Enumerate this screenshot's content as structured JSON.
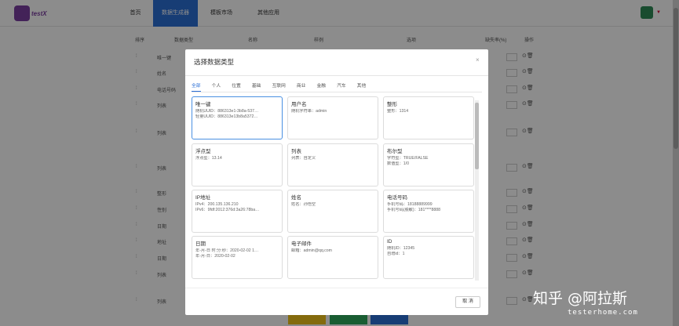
{
  "app": {
    "logo_text": "testX"
  },
  "nav": [
    {
      "label": "首页"
    },
    {
      "label": "数据生成器"
    },
    {
      "label": "模板市场"
    },
    {
      "label": "其他应用"
    }
  ],
  "table": {
    "headers": [
      "排序",
      "数据类型",
      "名称",
      "样例",
      "选项",
      "缺失率(%)",
      "操作"
    ],
    "rows": [
      {
        "label": "唯一键"
      },
      {
        "label": "姓名"
      },
      {
        "label": "电话号码"
      },
      {
        "label": "列表"
      },
      {
        "label": "列表"
      },
      {
        "label": "列表"
      },
      {
        "label": "整形"
      },
      {
        "label": "性别"
      },
      {
        "label": "日期"
      },
      {
        "label": "地址"
      },
      {
        "label": "日期"
      },
      {
        "label": "列表"
      },
      {
        "label": "列表"
      }
    ]
  },
  "modal": {
    "title": "选择数据类型",
    "close_symbol": "×",
    "tabs": [
      "全部",
      "个人",
      "位置",
      "基础",
      "互联网",
      "商业",
      "金融",
      "汽车",
      "其他"
    ],
    "active_tab": "全部",
    "cards": [
      {
        "title": "唯一键",
        "lines": [
          "随机UUID：886313e1-3b8a-537…",
          "轻量UUID：886313e13b8a5372…"
        ],
        "selected": true
      },
      {
        "title": "用户名",
        "lines": [
          "随机字符串：admin"
        ]
      },
      {
        "title": "整形",
        "lines": [
          "整形：1314"
        ]
      },
      {
        "title": "浮点型",
        "lines": [
          "浮点型：13.14"
        ]
      },
      {
        "title": "列表",
        "lines": [
          "列表：自定义"
        ]
      },
      {
        "title": "布尔型",
        "lines": [
          "字符型：TRUE/FALSE",
          "数值型：1/0"
        ]
      },
      {
        "title": "IP地址",
        "lines": [
          "IPv4：200.135.136.210",
          "IPv6：9fdf:2012:376d:3a26:78ba…"
        ]
      },
      {
        "title": "姓名",
        "lines": [
          "姓名：孙悟空"
        ]
      },
      {
        "title": "电话号码",
        "lines": [
          "手机号码：18188889999",
          "手机号码(脱敏)：181****8888"
        ]
      },
      {
        "title": "日期",
        "lines": [
          "年-月-日 时:分:秒：2020-02-02 1…",
          "年-月-日：2020-02-02"
        ]
      },
      {
        "title": "电子邮件",
        "lines": [
          "邮箱：admin@qq.com"
        ]
      },
      {
        "title": "ID",
        "lines": [
          "随机ID：12345",
          "自增id：1"
        ]
      }
    ],
    "cancel_label": "取 消"
  },
  "watermark": {
    "main": "知乎 @阿拉斯",
    "sub": "testerhome.com"
  },
  "colors": {
    "accent": "#2b6fd6",
    "logo": "#7b3fa0",
    "overlay": "rgba(0,0,0,0.45)"
  }
}
